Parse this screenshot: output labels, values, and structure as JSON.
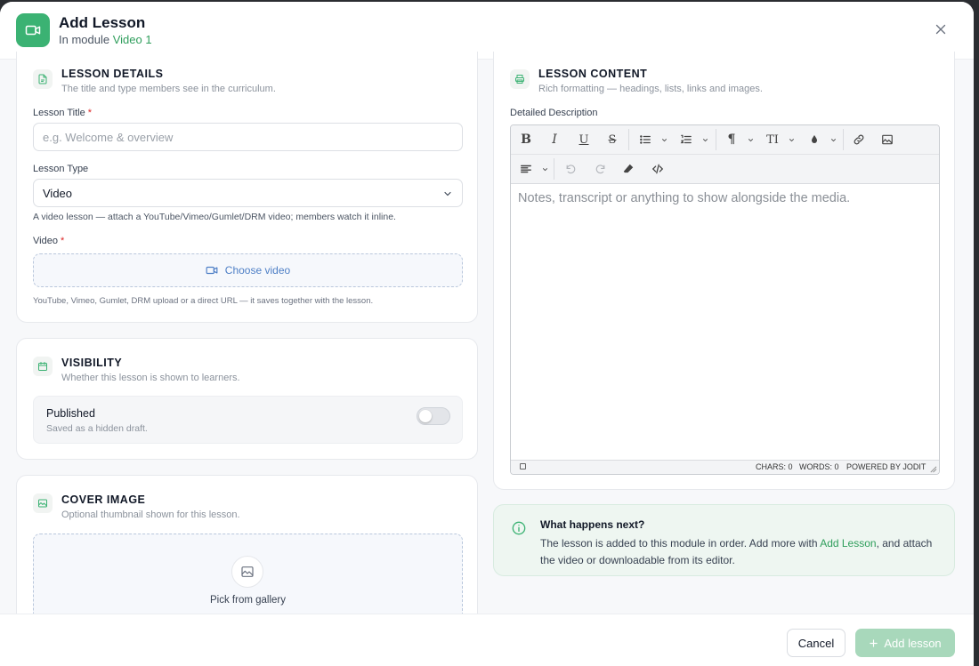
{
  "header": {
    "title": "Add Lesson",
    "subtitle_prefix": "In module",
    "module_name": "Video 1"
  },
  "details": {
    "title": "LESSON DETAILS",
    "subtitle": "The title and type members see in the curriculum.",
    "lesson_title_label": "Lesson Title",
    "required_mark": "*",
    "lesson_title_placeholder": "e.g. Welcome & overview",
    "lesson_type_label": "Lesson Type",
    "lesson_type_value": "Video",
    "lesson_type_help": "A video lesson — attach a YouTube/Vimeo/Gumlet/DRM video; members watch it inline.",
    "video_label": "Video",
    "choose_video": "Choose video",
    "video_help": "YouTube, Vimeo, Gumlet, DRM upload or a direct URL — it saves together with the lesson."
  },
  "visibility": {
    "title": "VISIBILITY",
    "subtitle": "Whether this lesson is shown to learners.",
    "published_label": "Published",
    "published_help": "Saved as a hidden draft.",
    "published": false
  },
  "cover": {
    "title": "COVER IMAGE",
    "subtitle": "Optional thumbnail shown for this lesson.",
    "pick_label": "Pick from gallery"
  },
  "content": {
    "title": "LESSON CONTENT",
    "subtitle": "Rich formatting — headings, lists, links and images.",
    "description_label": "Detailed Description",
    "editor_placeholder": "Notes, transcript or anything to show alongside the media.",
    "chars": "CHARS: 0",
    "words": "WORDS: 0",
    "powered": "POWERED BY JODIT"
  },
  "next": {
    "title": "What happens next?",
    "text_before": "The lesson is added to this module in order. Add more with ",
    "link": "Add Lesson",
    "text_after": ", and attach the video or downloadable from its editor."
  },
  "footer": {
    "cancel": "Cancel",
    "add": "Add lesson"
  },
  "colors": {
    "accent": "#3bb273",
    "accent_text": "#2f9e5c",
    "add_button_disabled": "#a8d8bb",
    "link_blue": "#4e7fc6"
  }
}
